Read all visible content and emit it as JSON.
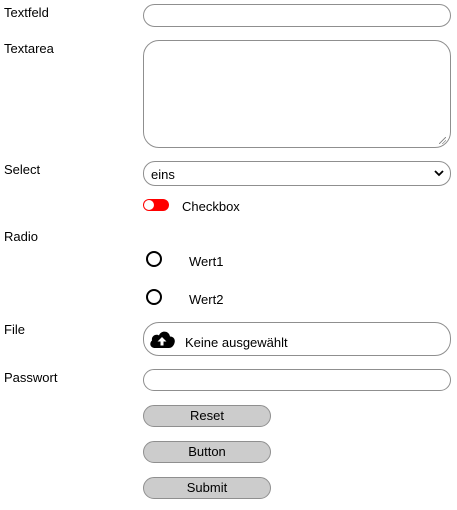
{
  "form": {
    "labels": {
      "textfield": "Textfeld",
      "textarea": "Textarea",
      "select": "Select",
      "radio": "Radio",
      "file": "File",
      "password": "Passwort"
    },
    "textfield_value": "",
    "textarea_value": "",
    "select_value": "eins",
    "checkbox": {
      "label": "Checkbox",
      "checked": false,
      "toggle_color": "#ff0000"
    },
    "radios": [
      {
        "label": "Wert1",
        "checked": false
      },
      {
        "label": "Wert2",
        "checked": false
      }
    ],
    "file": {
      "status": "Keine ausgewählt",
      "icon": "cloud-upload-icon"
    },
    "password_value": "",
    "buttons": {
      "reset": "Reset",
      "button": "Button",
      "submit": "Submit"
    }
  }
}
